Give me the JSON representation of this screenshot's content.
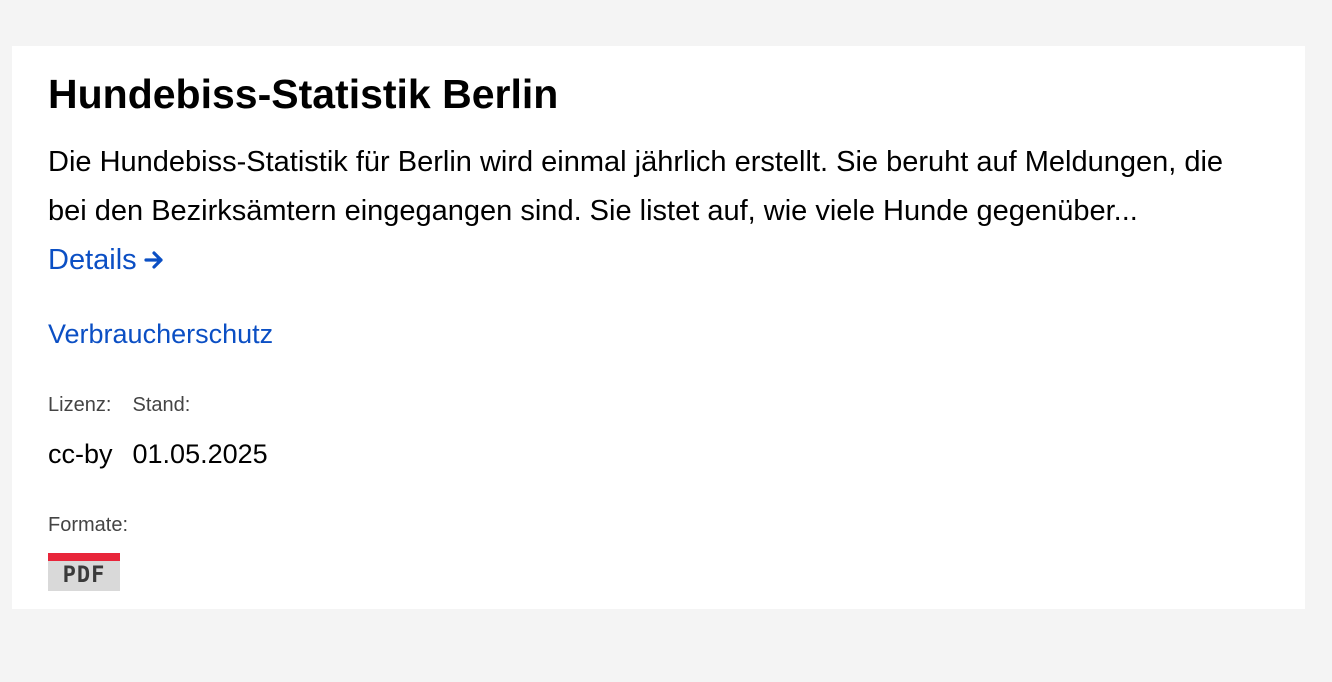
{
  "dataset": {
    "title": "Hundebiss-Statistik Berlin",
    "teaser": "Die Hundebiss-Statistik für Berlin wird einmal jährlich erstellt. Sie beruht auf Meldungen, die bei den Bezirksämtern eingegangen sind. Sie listet auf, wie viele Hunde gegenüber...",
    "details_label": "Details",
    "category": "Verbraucherschutz",
    "license_label": "Lizenz:",
    "license_value": "cc-by",
    "date_label": "Stand:",
    "date_value": "01.05.2025",
    "formats_label": "Formate:",
    "formats": [
      "PDF"
    ]
  },
  "colors": {
    "background": "#f4f4f4",
    "card": "#ffffff",
    "link": "#0b4fc4",
    "pdf_accent": "#e8253a",
    "pdf_badge": "#d9d9d9"
  },
  "icons": {
    "details_arrow": "arrow-right-icon"
  }
}
